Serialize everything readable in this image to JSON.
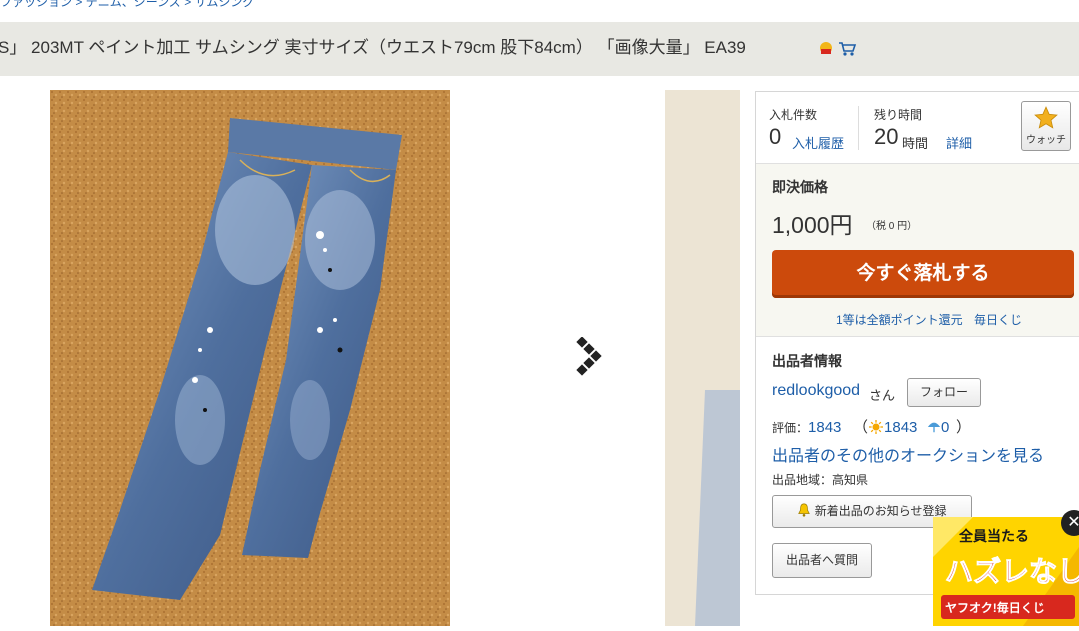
{
  "breadcrumb": {
    "items": [
      "ファッション",
      "デニム、ジーンズ",
      "サムシング"
    ],
    "separator": ">"
  },
  "item": {
    "title": "S」 203MT ペイント加工 サムシング 実寸サイズ（ウエスト79cm 股下84cm） 「画像大量」 EA39"
  },
  "gallery": {
    "main_image": "jeans-photo",
    "next_arrow": "next-arrow-icon"
  },
  "auction": {
    "bid_count_label": "入札件数",
    "bid_count": "0",
    "bid_history_link": "入札履歴",
    "time_left_label": "残り時間",
    "time_left_value": "20",
    "time_left_unit": "時間",
    "detail_link": "詳細",
    "watch_label": "ウォッチ",
    "buy_now_label": "即決価格",
    "buy_now_price": "1,000円",
    "tax_note": "（税 0 円）",
    "buy_now_button": "今すぐ落札する",
    "promo_link_1": "1等は全額ポイント還元",
    "promo_link_2": "毎日くじ"
  },
  "seller": {
    "heading": "出品者情報",
    "name": "redlookgood",
    "name_suffix": "さん",
    "follow_button": "フォロー",
    "rating_label": "評価：",
    "rating_total": "1843",
    "rating_paren_open": "（",
    "rating_good": "1843",
    "rating_bad": "0",
    "rating_paren_close": "）",
    "other_auctions_link": "出品者のその他のオークションを見る",
    "location": "出品地域：高知県",
    "notify_button": "新着出品のお知らせ登録",
    "question_button": "出品者へ質問"
  },
  "ad_banner": {
    "line1": "全員当たる",
    "line2": "ハズレなし",
    "line3": "ヤフオク!毎日くじ"
  },
  "colors": {
    "buy_button": "#cc4a0c",
    "link": "#1e5ea8",
    "title_bar": "#e8e8e3"
  }
}
